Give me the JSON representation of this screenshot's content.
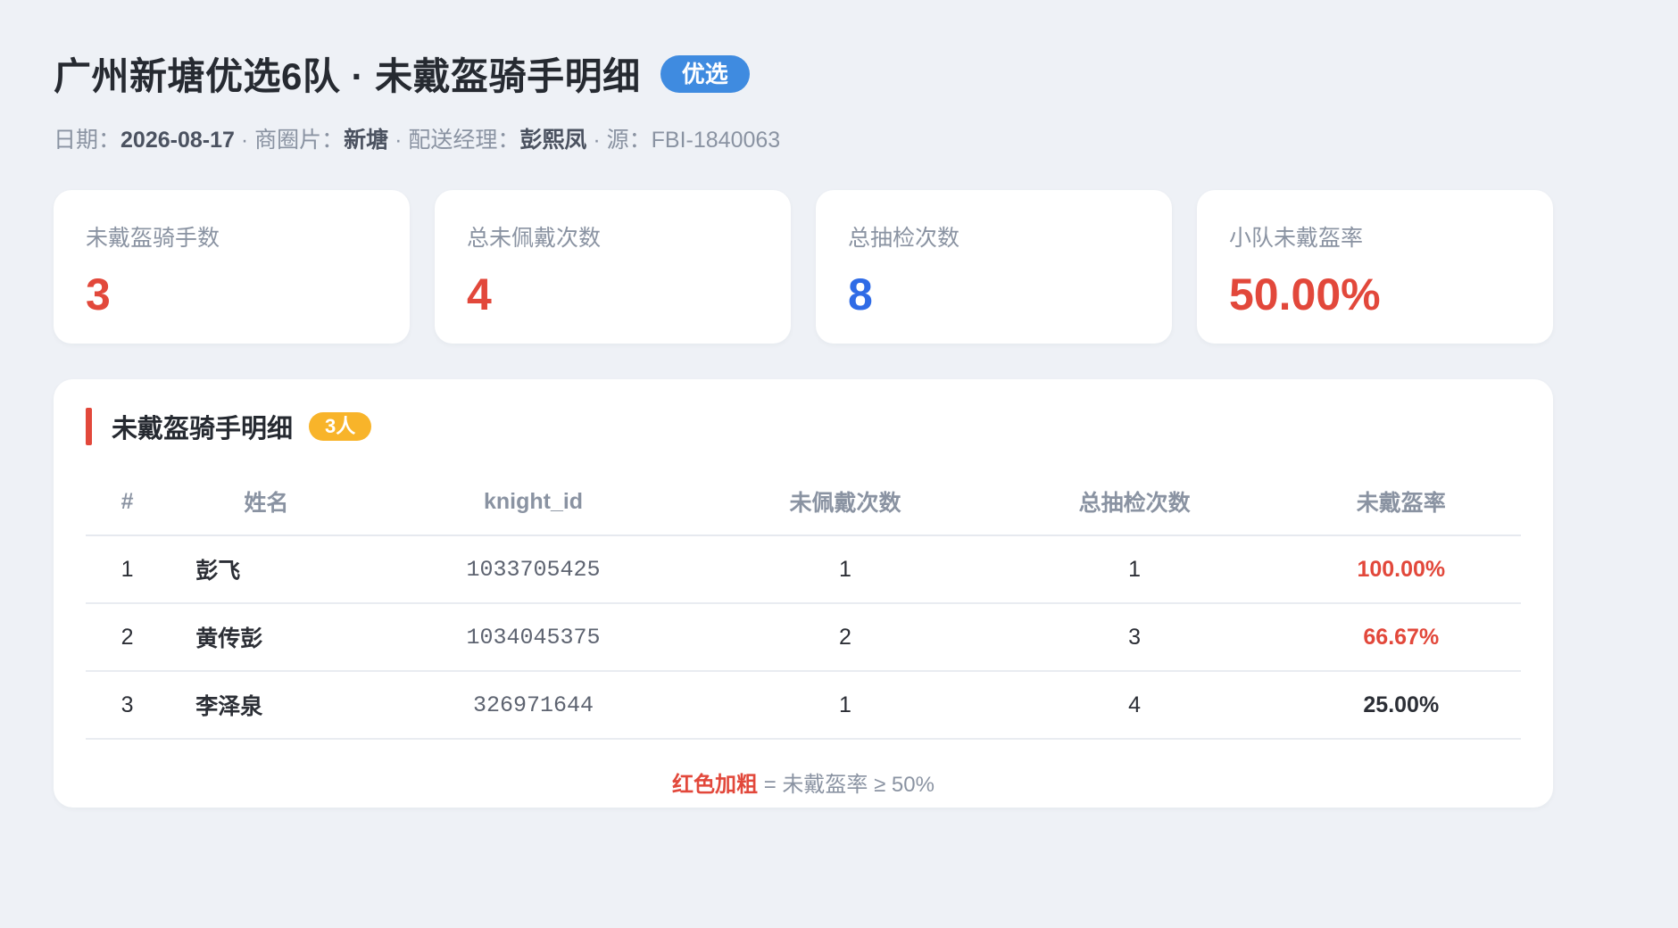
{
  "header": {
    "title": "广州新塘优选6队 · 未戴盔骑手明细",
    "tag": "优选",
    "meta": {
      "date_label": "日期：",
      "date": "2026-08-17",
      "sep1": " · ",
      "area_label": "商圈片：",
      "area": "新塘",
      "sep2": " · ",
      "manager_label": "配送经理：",
      "manager": "彭熙凤",
      "sep3": " · ",
      "source_label": "源：",
      "source": "FBI-1840063"
    }
  },
  "stats": [
    {
      "label": "未戴盔骑手数",
      "value": "3",
      "color": "#e2483b"
    },
    {
      "label": "总未佩戴次数",
      "value": "4",
      "color": "#e2483b"
    },
    {
      "label": "总抽检次数",
      "value": "8",
      "color": "#2f6be6"
    },
    {
      "label": "小队未戴盔率",
      "value": "50.00%",
      "color": "#e2483b"
    }
  ],
  "panel": {
    "title": "未戴盔骑手明细",
    "badge": "3人",
    "columns": [
      "#",
      "姓名",
      "knight_id",
      "未佩戴次数",
      "总抽检次数",
      "未戴盔率"
    ],
    "rows": [
      {
        "idx": "1",
        "name": "彭飞",
        "knight_id": "1033705425",
        "missed": "1",
        "total": "1",
        "rate": "100.00%",
        "highlight": true
      },
      {
        "idx": "2",
        "name": "黄传彭",
        "knight_id": "1034045375",
        "missed": "2",
        "total": "3",
        "rate": "66.67%",
        "highlight": true
      },
      {
        "idx": "3",
        "name": "李泽泉",
        "knight_id": "326971644",
        "missed": "1",
        "total": "4",
        "rate": "25.00%",
        "highlight": false
      }
    ],
    "legend_emph": "红色加粗",
    "legend_text": " = 未戴盔率 ≥ 50%"
  }
}
